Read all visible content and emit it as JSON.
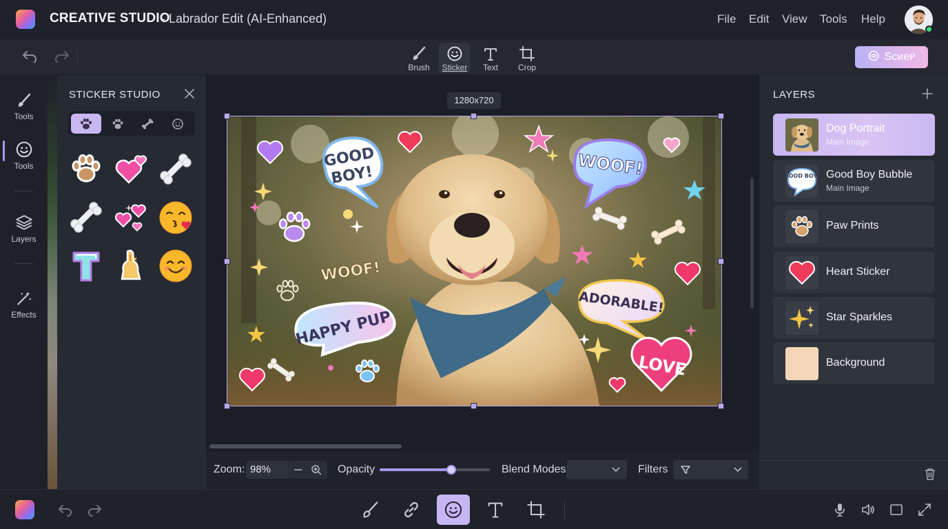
{
  "app": {
    "title_main": "CREATIVE STUDIO",
    "title_sub": "- Labrador Edit (AI-Enhanced)",
    "menu": [
      "File",
      "Edit",
      "View",
      "Tools",
      "Help"
    ]
  },
  "toolbar": {
    "tools": [
      {
        "label": "Brush",
        "icon": "brush-icon"
      },
      {
        "label": "Sticker",
        "icon": "smiley-icon",
        "active": true
      },
      {
        "label": "Text",
        "icon": "text-icon"
      },
      {
        "label": "Crop",
        "icon": "crop-icon"
      }
    ],
    "save_label": "Sᴄᴎeᴘ"
  },
  "left_rail": {
    "items": [
      {
        "label": "Tools",
        "icon": "brush-icon"
      },
      {
        "label": "Tools",
        "icon": "smiley-icon",
        "active": true
      },
      {
        "label": "Layers",
        "icon": "layers-icon"
      },
      {
        "label": "Effects",
        "icon": "magic-wand-icon"
      }
    ]
  },
  "sticker_studio": {
    "title": "STICKER STUDIO",
    "tabs": [
      "paw-icon",
      "dog-icon",
      "bone-icon",
      "smiley-icon"
    ],
    "active_tab": 0,
    "stickers": [
      "paw-sticker",
      "hearts-sticker",
      "bone-sticker",
      "bone-sticker",
      "sparkle-hearts-sticker",
      "kiss-emoji-sticker",
      "letter-t-sticker",
      "fist-sticker",
      "smile-emoji-sticker"
    ]
  },
  "canvas": {
    "size_label": "1280x720",
    "bubbles": {
      "good_boy_1": "GOOD",
      "good_boy_2": "BOY!",
      "woof_bubble": "WOOF!",
      "woof_free": "WOOF!",
      "adorable": "ADORABLE!",
      "happy_pup": "HAPPY PUP",
      "love": "LOVE"
    }
  },
  "props": {
    "zoom_label": "Zoom:",
    "zoom_value": "98%",
    "opacity_label": "Opacity",
    "opacity_value": 0.65,
    "blend_label": "Blend Modes",
    "blend_value": "",
    "filters_label": "Filters"
  },
  "layers": {
    "title": "LAYERS",
    "items": [
      {
        "name": "Dog Portrait",
        "sub": "Main Image",
        "active": true
      },
      {
        "name": "Good Boy Bubble",
        "sub": "Main Image",
        "thumb_text": "GOOD BOY!"
      },
      {
        "name": "Paw Prints",
        "sub": ""
      },
      {
        "name": "Heart Sticker",
        "sub": ""
      },
      {
        "name": "Star Sparkles",
        "sub": ""
      },
      {
        "name": "Background",
        "sub": ""
      }
    ]
  },
  "colors": {
    "accent": "#b9a8f0",
    "panel": "#262a33",
    "background": "#1b1e26"
  }
}
